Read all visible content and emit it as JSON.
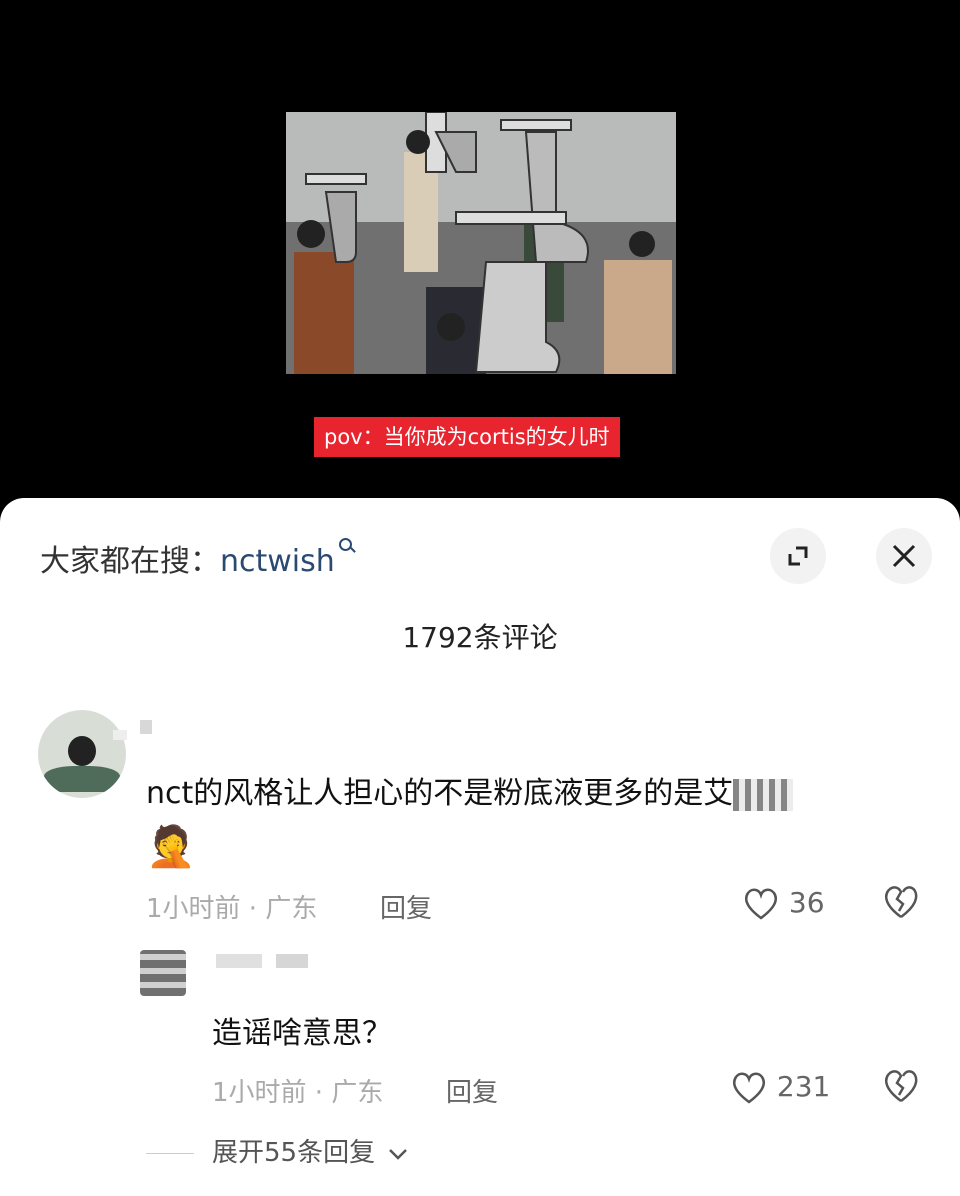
{
  "video": {
    "caption": "pov：当你成为cortis的女儿时"
  },
  "sheet": {
    "search_prefix": "大家都在搜：",
    "search_keyword": "nctwish",
    "comment_count_title": "1792条评论"
  },
  "comments": [
    {
      "text": "nct的风格让人担心的不是粉底液更多的是艾",
      "emoji": "🤦",
      "meta": "1小时前 · 广东",
      "reply_label": "回复",
      "likes": "36"
    }
  ],
  "replies": [
    {
      "text": "造谣啥意思？",
      "meta": "1小时前 · 广东",
      "reply_label": "回复",
      "likes": "231"
    }
  ],
  "expand_replies": "展开55条回复",
  "colors": {
    "caption_bg": "#e8242f",
    "keyword": "#2a4a72"
  }
}
